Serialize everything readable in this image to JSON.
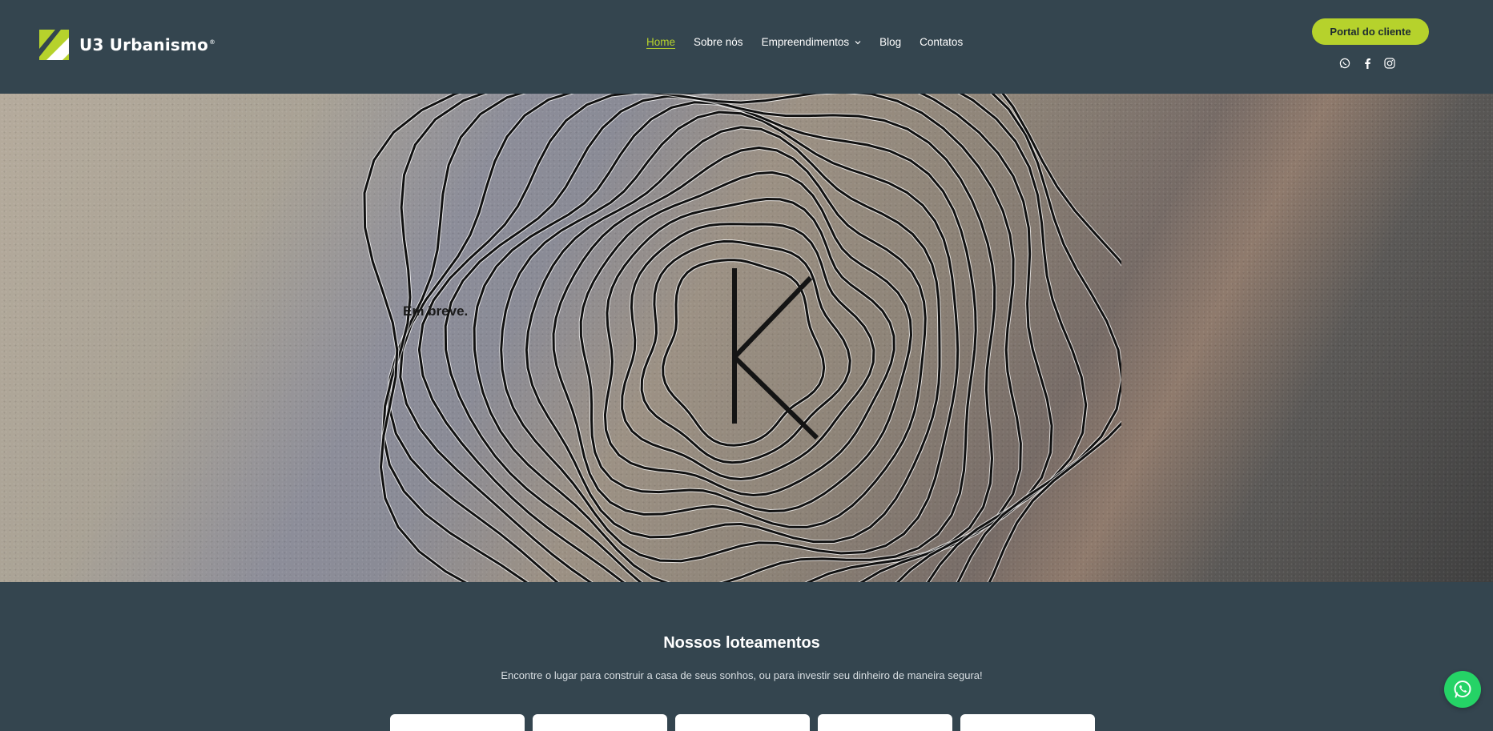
{
  "brand": {
    "name": "U3 Urbanismo",
    "reg": "®",
    "accent": "#b6d22c",
    "background": "#34454f"
  },
  "nav": {
    "items": [
      {
        "label": "Home",
        "active": true
      },
      {
        "label": "Sobre nós"
      },
      {
        "label": "Empreendimentos",
        "has_dropdown": true
      },
      {
        "label": "Blog"
      },
      {
        "label": "Contatos"
      }
    ]
  },
  "header": {
    "portal_label": "Portal do cliente",
    "socials": [
      "whatsapp-icon",
      "facebook-icon",
      "instagram-icon"
    ]
  },
  "hero": {
    "caption": "Em breve."
  },
  "section": {
    "title": "Nossos loteamentos",
    "subtitle": "Encontre o lugar para construir a casa de seus sonhos, ou para investir seu dinheiro de maneira segura!",
    "card_count": 5
  },
  "fab": {
    "icon": "whatsapp-icon",
    "color": "#25d366"
  }
}
